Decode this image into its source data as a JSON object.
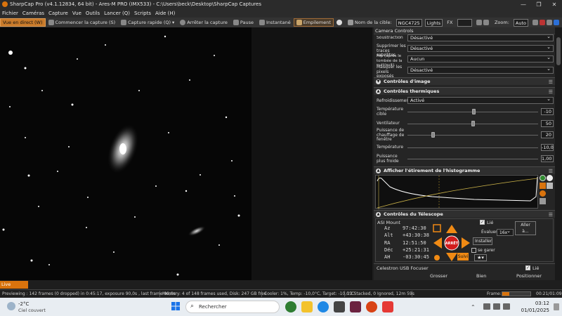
{
  "window": {
    "title": "SharpCap Pro (v4.1.12834, 64 bit) - Ares-M PRO (IMX533) - C:\\Users\\beck\\Desktop\\SharpCap Captures",
    "minimize": "—",
    "maximize": "❐",
    "close": "✕"
  },
  "menu": [
    "Fichier",
    "Caméras",
    "Capture",
    "Vue",
    "Outils",
    "Lancer (Q)",
    "Scripts",
    "Aide (H)"
  ],
  "toolbar": {
    "live_view": "Vue en direct (W)",
    "start_capture": "Commencer la capture (S)",
    "quick_capture": "Capture rapide (Q)",
    "stop_capture": "Arrêter la capture",
    "pause": "Pause",
    "snapshot": "Instantané",
    "stacking": "Empilement",
    "target_label": "Nom de la cible:",
    "target_value": "NGC4725",
    "filter_value": "Lights",
    "fx_label": "FX",
    "zoom_label": "Zoom:",
    "zoom_value": "Auto"
  },
  "panel": {
    "title": "Camera Controls",
    "rows_top": [
      {
        "label": "Soustraction d'arrière-plan",
        "value": "Désactivé"
      },
      {
        "label": "Supprimer les traces satellites",
        "value": "Désactivé"
      },
      {
        "label": "Fiip (après le tombée de la nuit/nuit)",
        "value": "Aucun"
      },
      {
        "label": "Masquer les pixels exposés",
        "value": "Désactivé"
      }
    ],
    "image_controls": "Contrôles d'image",
    "thermal_controls": "Contrôles thermiques",
    "cooling_label": "Refroidissement",
    "cooling_value": "Activé",
    "thermal_rows": [
      {
        "label": "Température cible",
        "value": "-10"
      },
      {
        "label": "Ventilateur",
        "value": "50"
      },
      {
        "label": "Puissance de chauffage de fenêtre",
        "value": "20"
      },
      {
        "label": "Température",
        "value": "-10,0"
      },
      {
        "label": "Puissance plus froide",
        "value": "1,00"
      }
    ],
    "histogram_title": "Afficher l'étirement de l'histogramme",
    "telescope_title": "Contrôles du Télescope",
    "mount_name": "ASI Mount",
    "linked_label": "Lié",
    "goto_label": "Aller à...",
    "coords": [
      {
        "k": "Az",
        "v": "97:42:30"
      },
      {
        "k": "Alt",
        "v": "+43:30:38"
      },
      {
        "k": "RA",
        "v": "12:51:50"
      },
      {
        "k": "Déc",
        "v": "+25:21:31"
      },
      {
        "k": "AH",
        "v": "-03:30:45"
      }
    ],
    "rate_label": "Évaluer",
    "rate_value": "16x",
    "install_label": "Installer",
    "park_label": "se garer",
    "stop_label": "ARRÊT",
    "follow_label": "Suivi",
    "focuser_name": "Celestron USB Focuser",
    "focus_buttons": [
      "Grosser",
      "Bien",
      "Positionner"
    ]
  },
  "live_stacking_tab": "Live Stacking",
  "status": {
    "preview": "Previewing : 142 frames (0 dropped) in 0:45:17, exposure 90,0s , last frame 90,0s",
    "memory": "Memory: 4 of 148 frames used, Disk: 247 GB free",
    "cooler": "Cooler: 1%, Temp: -10,0°C, Target: -10,0°C",
    "stacked": "12 Stacked, 0 Ignored, 12m 59s",
    "frame_label": "Frame:",
    "time": "00:21/01:09"
  },
  "taskbar": {
    "weather_temp": "-2°C",
    "weather_desc": "Ciel couvert",
    "search_placeholder": "Rechercher",
    "clock_time": "03:12",
    "clock_date": "01/01/2025"
  },
  "colors": {
    "accent": "#d9730d",
    "stop_red": "#d11c1c",
    "arrow_orange": "#f08a14"
  }
}
